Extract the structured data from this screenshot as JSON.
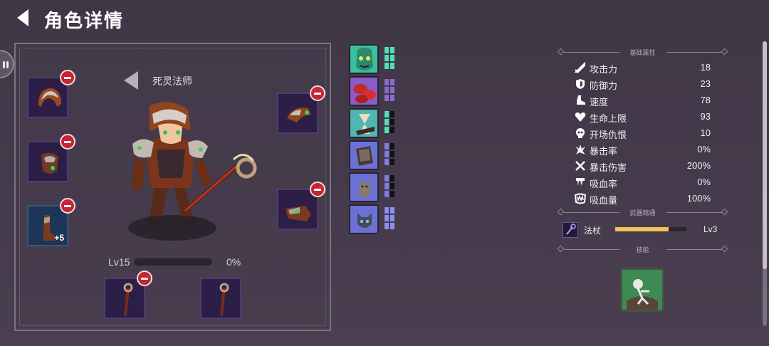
{
  "header": {
    "title": "角色详情",
    "back_icon": "back-arrow-icon"
  },
  "character": {
    "class_name": "死灵法师",
    "level_label": "Lv15",
    "xp_percent_text": "0%",
    "xp_progress": 0
  },
  "equipment": {
    "left_slots": [
      {
        "icon": "helmet-icon",
        "removable": true
      },
      {
        "icon": "mask-icon",
        "removable": true
      },
      {
        "icon": "boots-icon",
        "removable": true,
        "bonus": "+5"
      }
    ],
    "right_slots": [
      {
        "icon": "shoulder-armor-icon",
        "removable": true
      },
      {
        "icon": "gauntlet-icon",
        "removable": true
      }
    ],
    "bottom_slots": [
      {
        "icon": "staff-icon",
        "removable": true
      },
      {
        "icon": "staff-icon",
        "removable": false
      }
    ]
  },
  "skills": [
    {
      "icon": "witch-face-icon",
      "bg": "#3bbf9f",
      "pip_color": "#4fe0b7",
      "filled": 6,
      "total": 6
    },
    {
      "icon": "red-coins-icon",
      "bg": "#8b5cc8",
      "pip_color": "#8b6bd0",
      "filled": 6,
      "total": 6
    },
    {
      "icon": "hourglass-icon",
      "bg": "#4fb6b2",
      "pip_color": "#4fe0b7",
      "filled": 2,
      "total": 6
    },
    {
      "icon": "spellbook-icon",
      "bg": "#6b72d6",
      "pip_color": "#7b7fe8",
      "filled": 2,
      "total": 6
    },
    {
      "icon": "cat-statue-icon",
      "bg": "#6b72d6",
      "pip_color": "#7b7fe8",
      "filled": 2,
      "total": 6
    },
    {
      "icon": "wolf-icon",
      "bg": "#6b72d6",
      "pip_color": "#8a8ff0",
      "filled": 6,
      "total": 6
    }
  ],
  "stats": {
    "section_title": "基础属性",
    "rows": [
      {
        "icon": "sword-icon",
        "name": "攻击力",
        "value": "18"
      },
      {
        "icon": "shield-icon",
        "name": "防御力",
        "value": "23"
      },
      {
        "icon": "boot-icon",
        "name": "速度",
        "value": "78"
      },
      {
        "icon": "heart-icon",
        "name": "生命上限",
        "value": "93"
      },
      {
        "icon": "skull-icon",
        "name": "开场仇恨",
        "value": "10"
      },
      {
        "icon": "crit-icon",
        "name": "暴击率",
        "value": "0%"
      },
      {
        "icon": "crit-damage-icon",
        "name": "暴击伤害",
        "value": "200%"
      },
      {
        "icon": "fang-icon",
        "name": "吸血率",
        "value": "0%"
      },
      {
        "icon": "teeth-icon",
        "name": "吸血量",
        "value": "100%"
      }
    ]
  },
  "weapon_mastery": {
    "section_title": "武器精通",
    "name": "法杖",
    "level": "Lv3",
    "progress": 0.75
  },
  "skill_section": {
    "section_title": "技能",
    "icon": "skeleton-skill-icon"
  },
  "colors": {
    "accent": "#f2c35a",
    "remove": "#c42634",
    "slot_bg": "#2c1e47"
  }
}
